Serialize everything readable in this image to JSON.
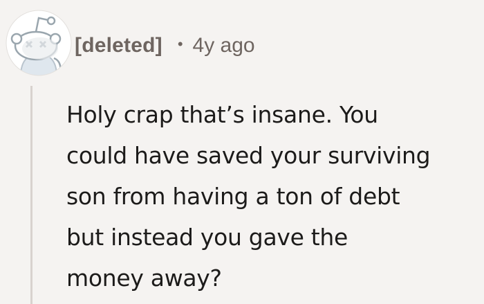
{
  "comment": {
    "author": "[deleted]",
    "separator": "•",
    "timestamp": "4y ago",
    "body_lines": [
      "Holy crap that’s insane. You",
      "could have saved your surviving",
      "son from having a ton of debt",
      "but instead you gave the",
      "money away?"
    ]
  },
  "colors": {
    "background": "#f5f3f1",
    "meta_text": "#6e6560",
    "body_text": "#1c1b1a",
    "thread_line": "#d8d2ce"
  }
}
